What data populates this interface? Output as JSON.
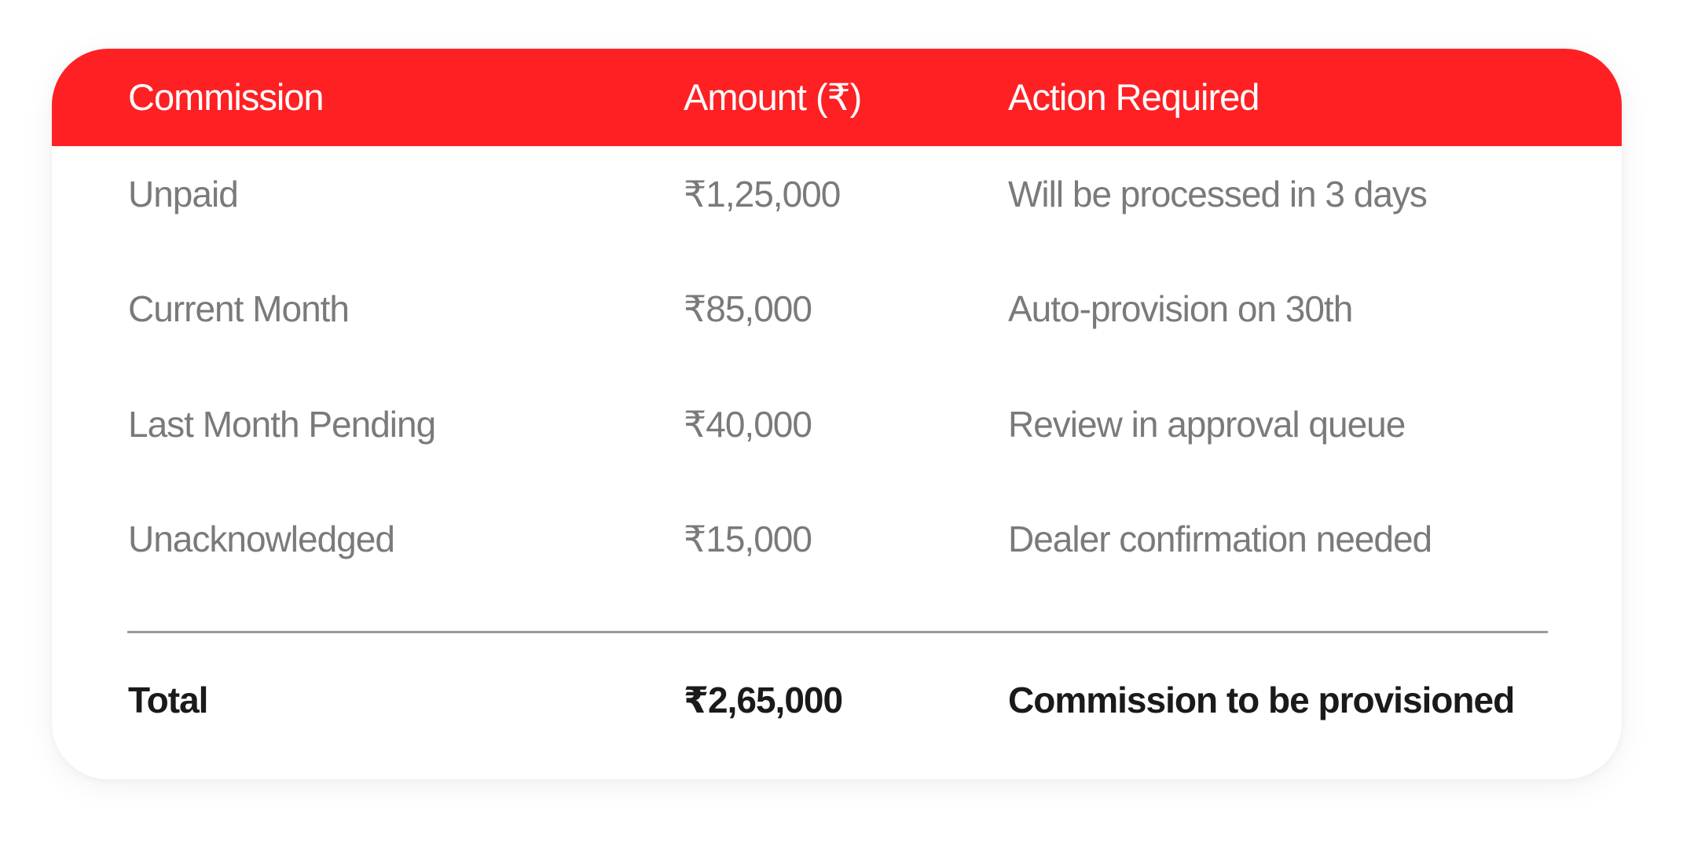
{
  "table": {
    "headers": [
      "Commission",
      "Amount (₹)",
      "Action Required"
    ],
    "rows": [
      [
        "Unpaid",
        "₹1,25,000",
        "Will be processed in 3 days"
      ],
      [
        "Current Month",
        "₹85,000",
        "Auto-provision on 30th"
      ],
      [
        "Last Month Pending",
        "₹40,000",
        "Review in approval queue"
      ],
      [
        "Unacknowledged",
        "₹15,000",
        "Dealer confirmation needed"
      ]
    ],
    "total": [
      "Total",
      "₹2,65,000",
      "Commission to be provisioned"
    ]
  },
  "colors": {
    "header_bg": "#ff2024",
    "header_text": "#ffffff",
    "body_text": "#7a7a7a",
    "total_text": "#1a1a1a",
    "divider": "#9a9a9a"
  }
}
